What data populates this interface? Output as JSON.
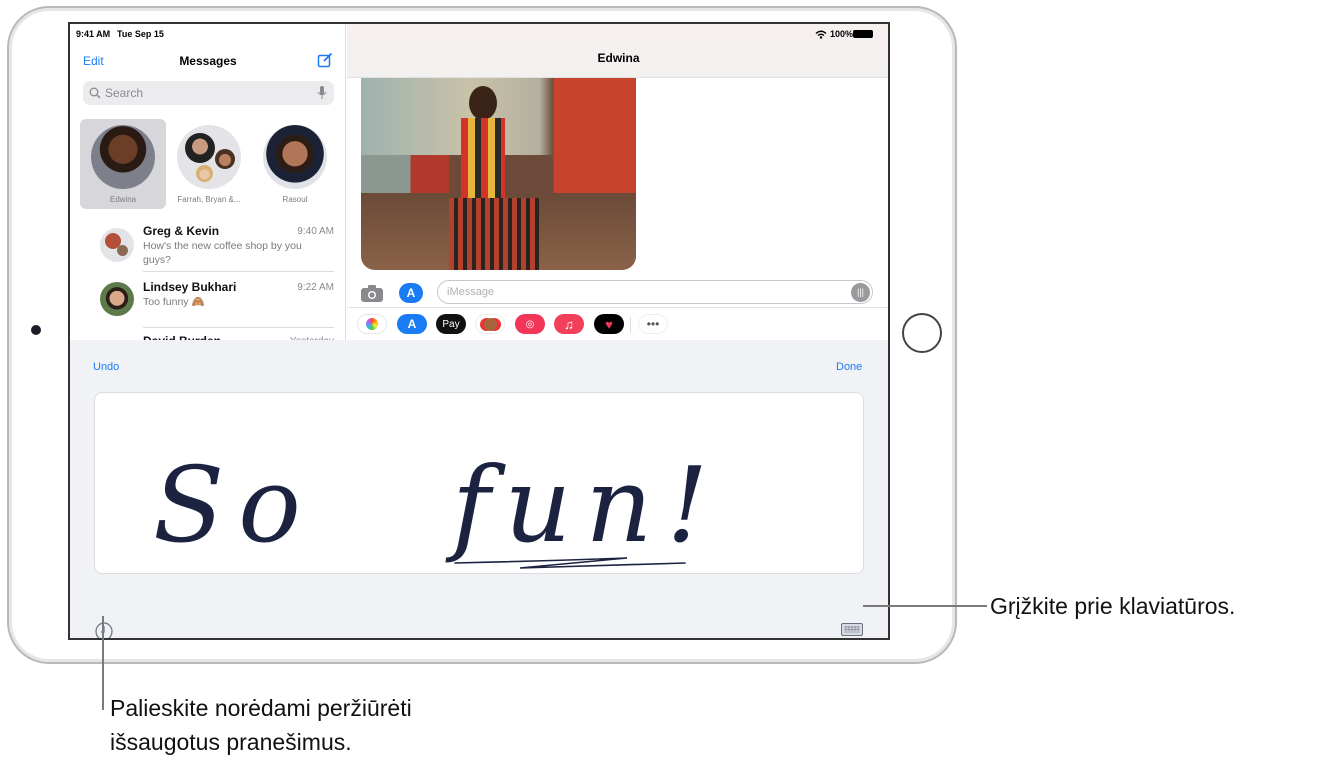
{
  "status_bar": {
    "time": "9:41 AM",
    "date": "Tue Sep 15",
    "battery": "100%"
  },
  "sidebar": {
    "edit_label": "Edit",
    "title": "Messages",
    "search_placeholder": "Search",
    "pinned": [
      {
        "name": "Edwina"
      },
      {
        "name": "Farrah, Bryan &..."
      },
      {
        "name": "Rasoul"
      }
    ],
    "conversations": [
      {
        "name": "Greg & Kevin",
        "time": "9:40 AM",
        "preview": "How's the new coffee shop by you guys?"
      },
      {
        "name": "Lindsey Bukhari",
        "time": "9:22 AM",
        "preview": "Too funny 🙈"
      },
      {
        "name": "David Burden",
        "time": "Yesterday",
        "preview": ""
      }
    ]
  },
  "chat": {
    "contact": "Edwina",
    "input_placeholder": "iMessage",
    "apps": [
      "photos-icon",
      "app-store-icon",
      "apple-pay-icon",
      "memoji-icon",
      "web-search-icon",
      "music-icon",
      "digital-touch-icon",
      "more-icon"
    ],
    "apple_pay_label": "Pay"
  },
  "handwriting": {
    "undo_label": "Undo",
    "done_label": "Done",
    "text": "So fun!"
  },
  "callouts": {
    "keyboard": "Grįžkite prie klaviatūros.",
    "history_line1": "Palieskite norėdami peržiūrėti",
    "history_line2": "išsaugotus pranešimus."
  },
  "colors": {
    "accent": "#1a7cf5",
    "panel": "#f1f2f6",
    "ink": "#1c2340"
  }
}
